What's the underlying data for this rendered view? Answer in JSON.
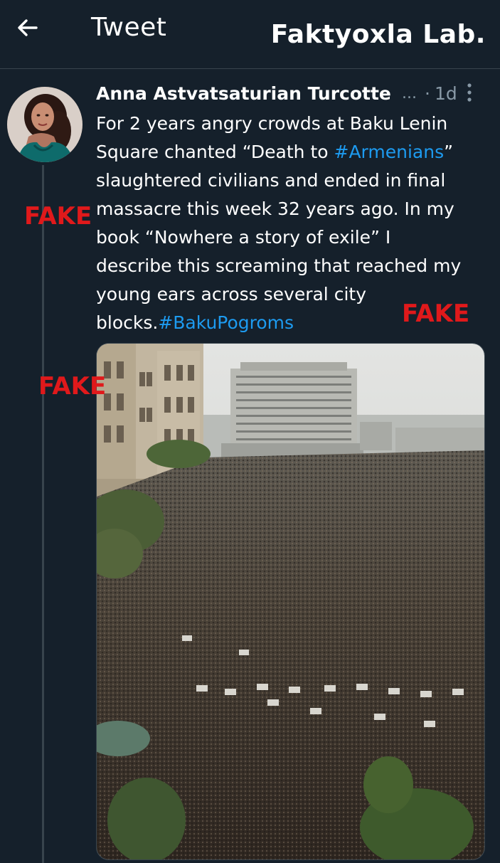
{
  "header": {
    "title": "Tweet",
    "watermark": "Faktyoxla Lab."
  },
  "tweet": {
    "author_name": "Anna Astvatsaturian Turcotte",
    "author_ellipsis": "...",
    "separator": "·",
    "timestamp": "1d",
    "text_lines": [
      [
        {
          "t": "For 2 years angry crowds at Baku Lenin",
          "tag": false
        }
      ],
      [
        {
          "t": "Square chanted “Death to ",
          "tag": false
        },
        {
          "t": "#Armenians",
          "tag": true
        },
        {
          "t": "”",
          "tag": false
        }
      ],
      [
        {
          "t": "slaughtered civilians and ended in final",
          "tag": false
        }
      ],
      [
        {
          "t": "massacre this week 32 years ago. In my",
          "tag": false
        }
      ],
      [
        {
          "t": "book “Nowhere a story of exile” I",
          "tag": false
        }
      ],
      [
        {
          "t": "describe this screaming that reached my",
          "tag": false
        }
      ],
      [
        {
          "t": "young ears across several city",
          "tag": false
        }
      ],
      [
        {
          "t": "blocks.",
          "tag": false
        },
        {
          "t": "#BakuPogroms",
          "tag": true
        }
      ]
    ],
    "hashtag_color": "#1d9bf0"
  },
  "overlays": {
    "fake_1": "FAKE",
    "fake_2": "FAKE",
    "fake_3": "FAKE",
    "color": "#e0191b"
  },
  "icons": {
    "back": "arrow-left-icon",
    "more": "more-vertical-icon"
  },
  "colors": {
    "background": "#15202b",
    "border": "#38444d",
    "secondary_text": "#8899a6"
  }
}
